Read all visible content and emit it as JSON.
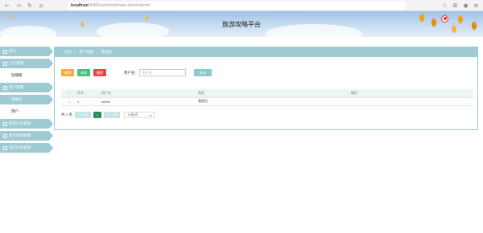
{
  "browser": {
    "url_host": "localhost",
    "url_path": ":8080/ssm/front/index.html#/admin"
  },
  "header": {
    "title": "旅游攻略平台"
  },
  "sidebar": {
    "items": [
      {
        "label": "首页",
        "icon": "home-icon"
      },
      {
        "label": "公告管理",
        "icon": "notice-icon"
      }
    ],
    "sub_1": "轮播图",
    "section": {
      "label": "用户管理",
      "icon": "user-icon"
    },
    "subs": [
      "管理员",
      "用户"
    ],
    "more": [
      {
        "label": "旅游信息管理",
        "icon": "menu-icon"
      },
      {
        "label": "景点攻略管理",
        "icon": "menu-icon"
      },
      {
        "label": "酒店信息管理",
        "icon": "menu-icon"
      }
    ]
  },
  "breadcrumb": {
    "items": [
      "首页",
      "用户管理",
      "管理员"
    ]
  },
  "toolbar": {
    "add_label": "新增",
    "edit_label": "修改",
    "delete_label": "删除",
    "search_label": "用户名:",
    "search_placeholder": "用户名",
    "query_label": "查询"
  },
  "table": {
    "columns": [
      "序号",
      "用户名",
      "角色",
      "操作"
    ],
    "rows": [
      {
        "index": "1",
        "username": "admin",
        "role": "管理员",
        "op": ""
      }
    ]
  },
  "pager": {
    "total": "共 1 条",
    "prev": "上一页",
    "current": "1",
    "next": "下一页",
    "size": "10条/页"
  },
  "colors": {
    "accent": "#9dcad3",
    "add": "#f6ab3c",
    "edit": "#48c07b",
    "delete": "#e8454a"
  }
}
